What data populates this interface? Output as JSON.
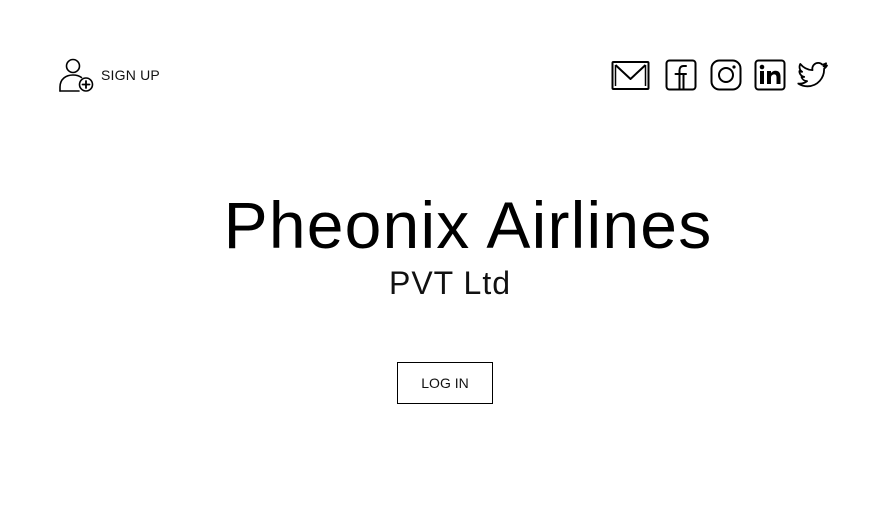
{
  "header": {
    "signup_label": "SIGN UP",
    "signup_icon": "user-add-icon",
    "social_icons": [
      "mail-icon",
      "facebook-icon",
      "instagram-icon",
      "linkedin-icon",
      "twitter-icon"
    ]
  },
  "hero": {
    "title": "Pheonix Airlines",
    "subtitle": "PVT Ltd"
  },
  "actions": {
    "login_label": "LOG IN"
  }
}
